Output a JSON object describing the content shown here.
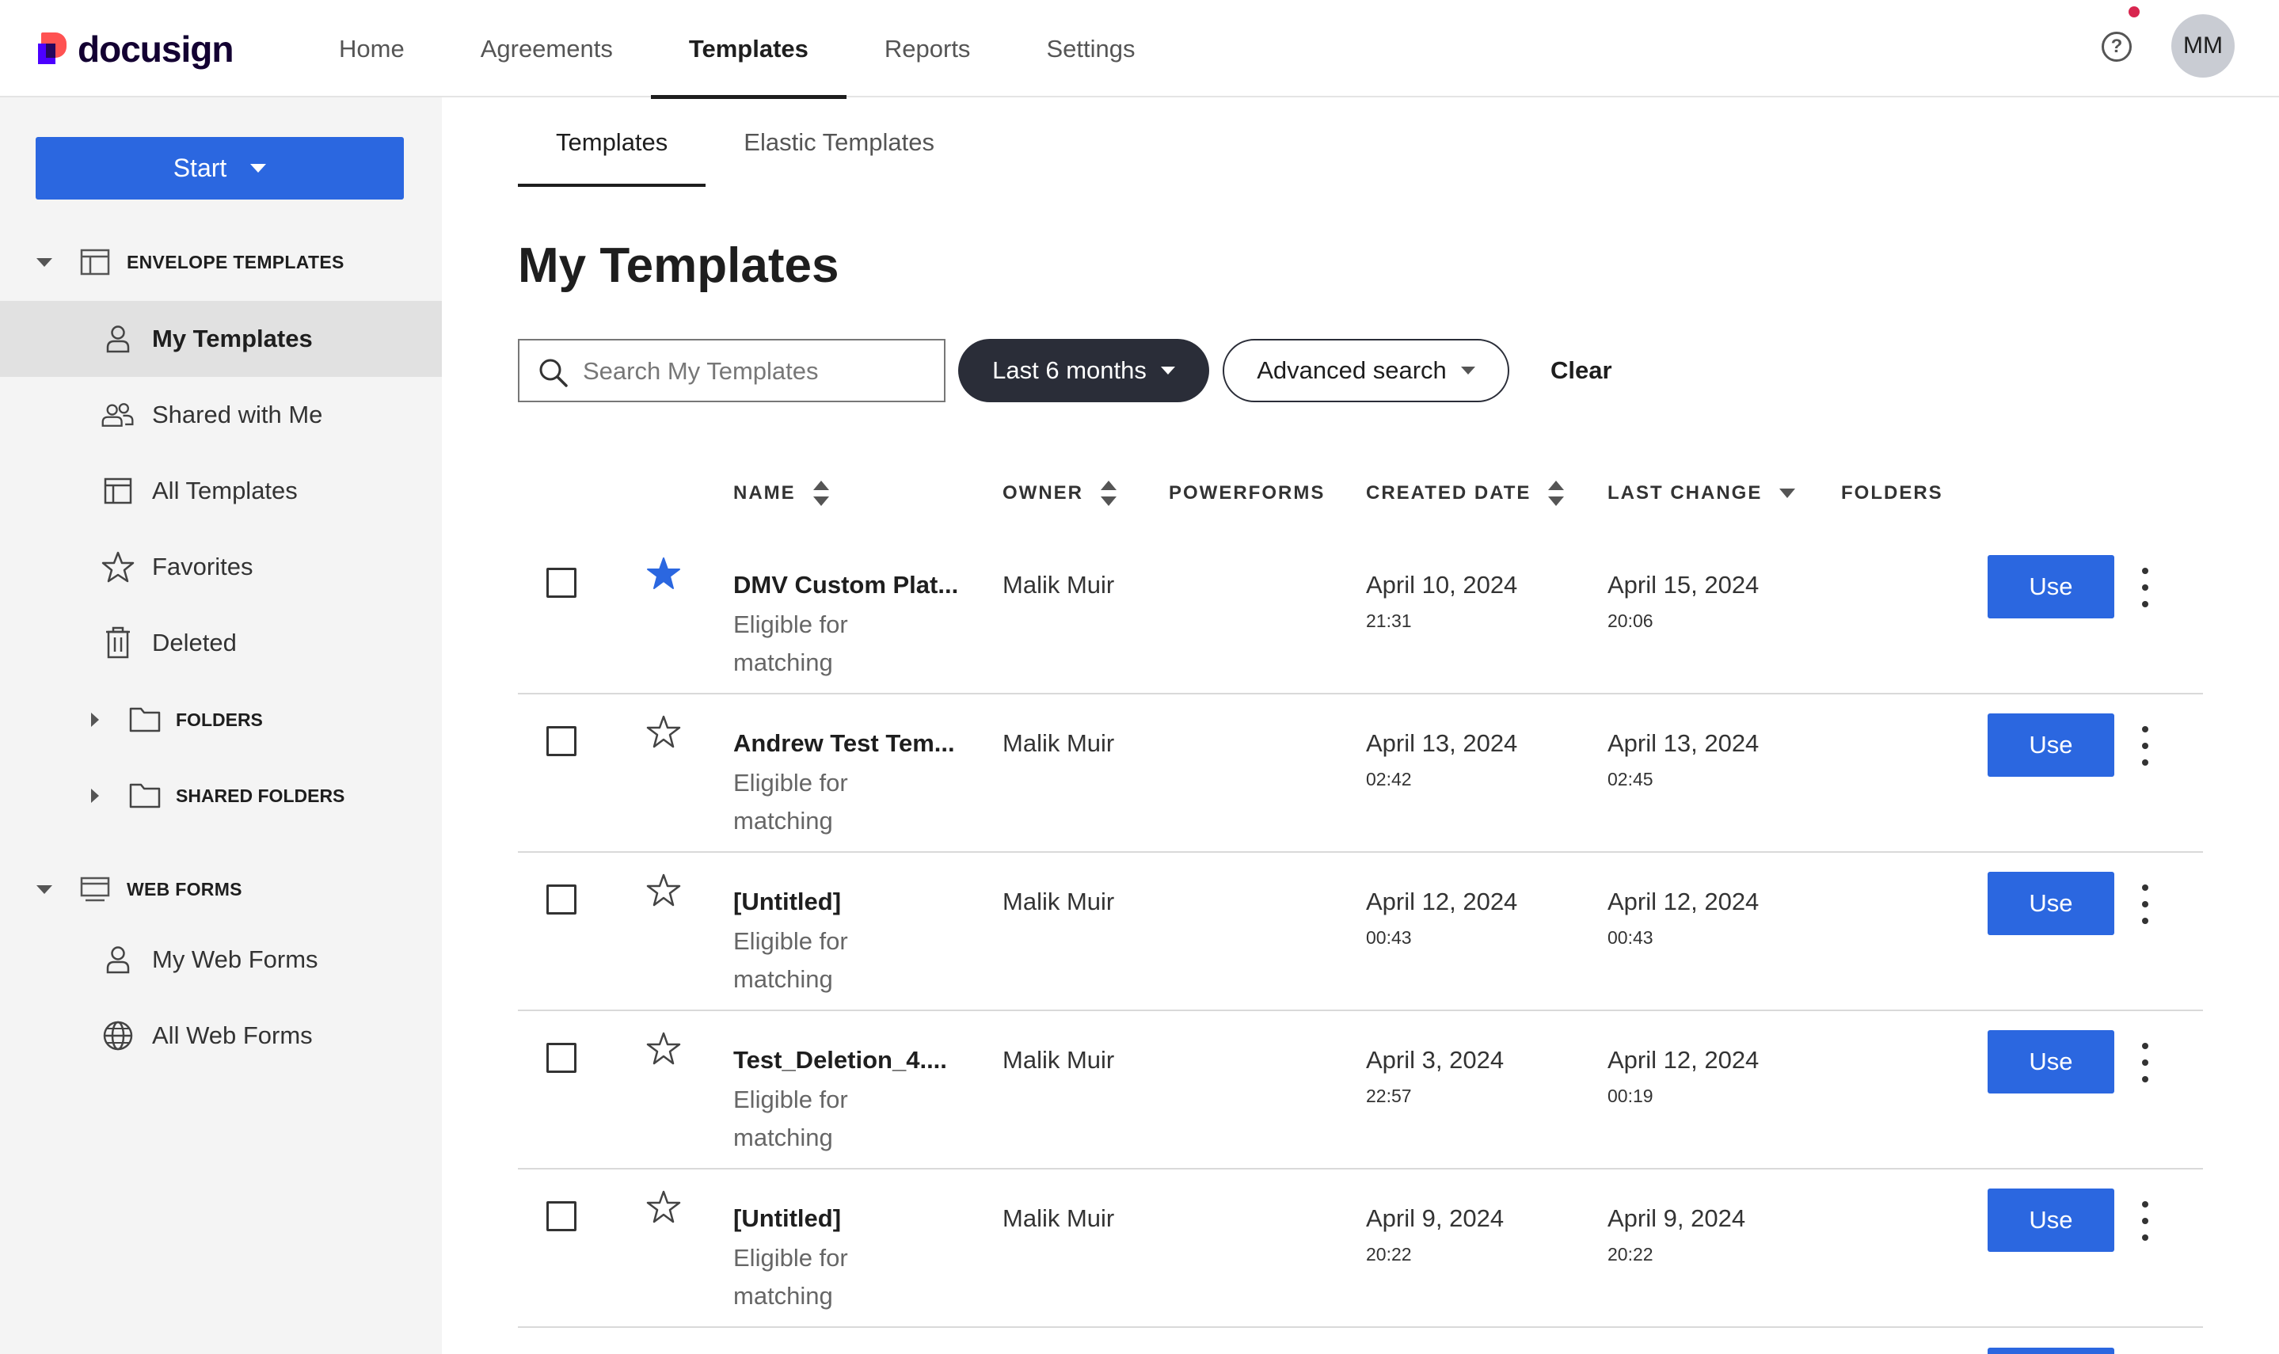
{
  "brand": {
    "logo_text": "docusign"
  },
  "nav": {
    "items": [
      {
        "label": "Home"
      },
      {
        "label": "Agreements"
      },
      {
        "label": "Templates"
      },
      {
        "label": "Reports"
      },
      {
        "label": "Settings"
      }
    ],
    "active": "Templates",
    "help_icon": "question-circle-icon",
    "avatar_initials": "MM"
  },
  "sidebar": {
    "start_label": "Start",
    "envelope_templates_heading": "ENVELOPE TEMPLATES",
    "items": [
      {
        "label": "My Templates",
        "icon": "person-icon",
        "active": true
      },
      {
        "label": "Shared with Me",
        "icon": "people-icon"
      },
      {
        "label": "All Templates",
        "icon": "template-icon"
      },
      {
        "label": "Favorites",
        "icon": "star-icon"
      },
      {
        "label": "Deleted",
        "icon": "trash-icon"
      }
    ],
    "folders_label": "FOLDERS",
    "shared_folders_label": "SHARED FOLDERS",
    "web_forms_heading": "WEB FORMS",
    "web_form_items": [
      {
        "label": "My Web Forms",
        "icon": "person-icon"
      },
      {
        "label": "All Web Forms",
        "icon": "globe-icon"
      }
    ]
  },
  "main": {
    "tabs": [
      {
        "label": "Templates",
        "active": true
      },
      {
        "label": "Elastic Templates"
      }
    ],
    "title": "My Templates",
    "search": {
      "placeholder": "Search My Templates",
      "value": ""
    },
    "date_filter": "Last 6 months",
    "advanced_search": "Advanced search",
    "clear": "Clear",
    "columns": {
      "name": "NAME",
      "owner": "OWNER",
      "powerforms": "POWERFORMS",
      "created_date": "CREATED DATE",
      "last_change": "LAST CHANGE",
      "folders": "FOLDERS"
    },
    "rows": [
      {
        "name": "DMV Custom Plat...",
        "sub": "Eligible for matching",
        "owner": "Malik Muir",
        "created_date": "April 10, 2024",
        "created_time": "21:31",
        "changed_date": "April 15, 2024",
        "changed_time": "20:06",
        "favorite": true,
        "action": "Use"
      },
      {
        "name": "Andrew Test Tem...",
        "sub": "Eligible for matching",
        "owner": "Malik Muir",
        "created_date": "April 13, 2024",
        "created_time": "02:42",
        "changed_date": "April 13, 2024",
        "changed_time": "02:45",
        "favorite": false,
        "action": "Use"
      },
      {
        "name": "[Untitled]",
        "sub": "Eligible for matching",
        "owner": "Malik Muir",
        "created_date": "April 12, 2024",
        "created_time": "00:43",
        "changed_date": "April 12, 2024",
        "changed_time": "00:43",
        "favorite": false,
        "action": "Use"
      },
      {
        "name": "Test_Deletion_4....",
        "sub": "Eligible for matching",
        "owner": "Malik Muir",
        "created_date": "April 3, 2024",
        "created_time": "22:57",
        "changed_date": "April 12, 2024",
        "changed_time": "00:19",
        "favorite": false,
        "action": "Use"
      },
      {
        "name": "[Untitled]",
        "sub": "Eligible for matching",
        "owner": "Malik Muir",
        "created_date": "April 9, 2024",
        "created_time": "20:22",
        "changed_date": "April 9, 2024",
        "changed_time": "20:22",
        "favorite": false,
        "action": "Use"
      }
    ]
  },
  "colors": {
    "primary_blue": "#2b67e0",
    "dark_chip": "#2a2d38",
    "notification": "#d8264f",
    "sidebar_bg": "#f4f4f4",
    "sidebar_active": "#e1e1e1"
  }
}
